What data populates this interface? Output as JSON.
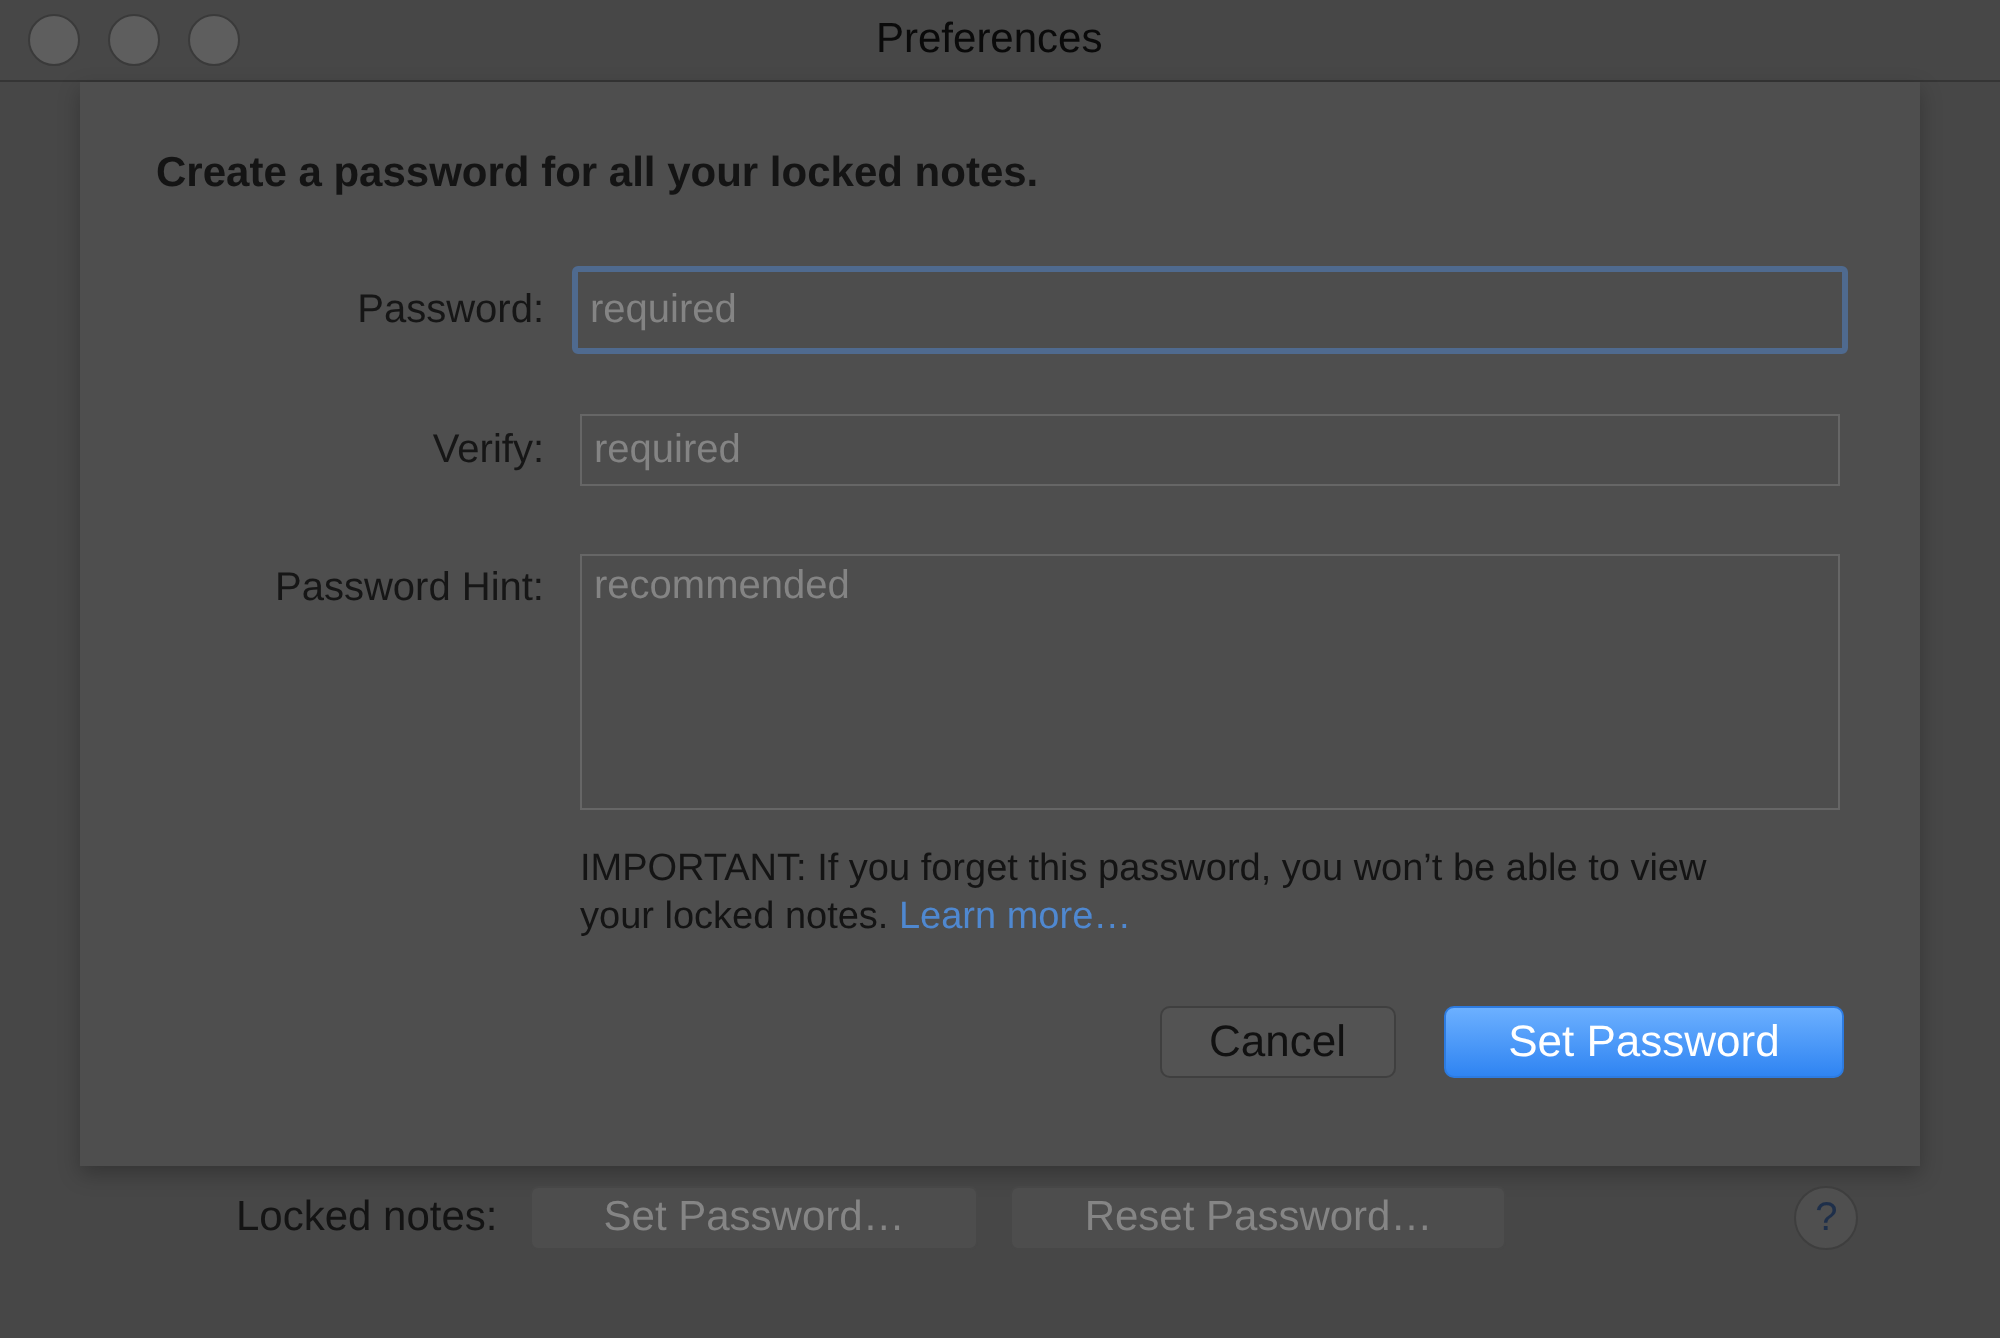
{
  "window": {
    "title": "Preferences"
  },
  "sheet": {
    "heading": "Create a password for all your locked notes.",
    "fields": [
      {
        "label": "Password:",
        "placeholder": "required",
        "kind": "single",
        "focused": true
      },
      {
        "label": "Verify:",
        "placeholder": "required",
        "kind": "single",
        "focused": false
      },
      {
        "label": "Password Hint:",
        "placeholder": "recommended",
        "kind": "multi",
        "focused": false
      }
    ],
    "notice": {
      "text": "IMPORTANT: If you forget this password, you won’t be able to view your locked notes.",
      "link": "Learn more…"
    },
    "buttons": [
      {
        "label": "Cancel",
        "kind": "default"
      },
      {
        "label": "Set Password",
        "kind": "primary"
      }
    ]
  },
  "locked_notes": {
    "label": "Locked notes:",
    "buttons": [
      {
        "label": "Set Password…",
        "disabled": true
      },
      {
        "label": "Reset Password…",
        "disabled": true
      }
    ],
    "help": "?"
  }
}
